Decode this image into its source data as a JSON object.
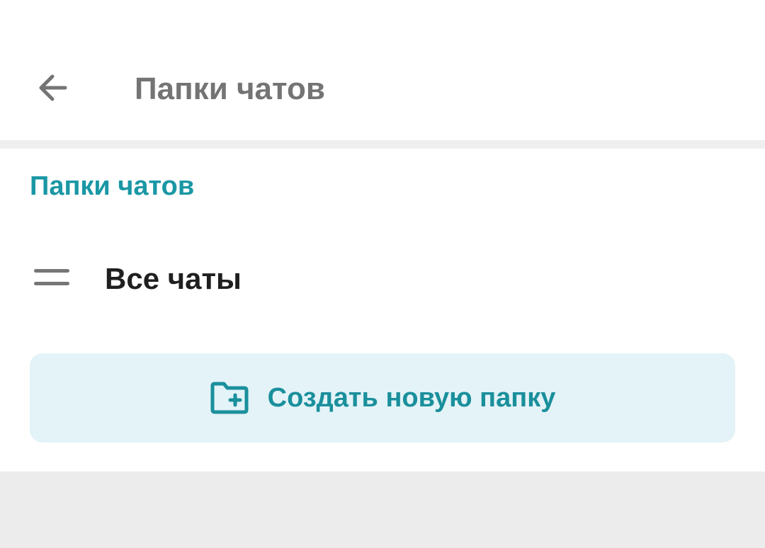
{
  "app_bar": {
    "title": "Папки чатов",
    "back_icon": "arrow-left-icon"
  },
  "section": {
    "header": "Папки чатов",
    "folders": [
      {
        "label": "Все чаты",
        "icon": "drag-handle-icon"
      }
    ],
    "create_button": {
      "label": "Создать новую папку",
      "icon": "folder-plus-icon"
    }
  },
  "colors": {
    "accent": "#1a97a5",
    "button_background": "#e3f3f7",
    "page_background": "#ececec",
    "title_gray": "#747474"
  }
}
